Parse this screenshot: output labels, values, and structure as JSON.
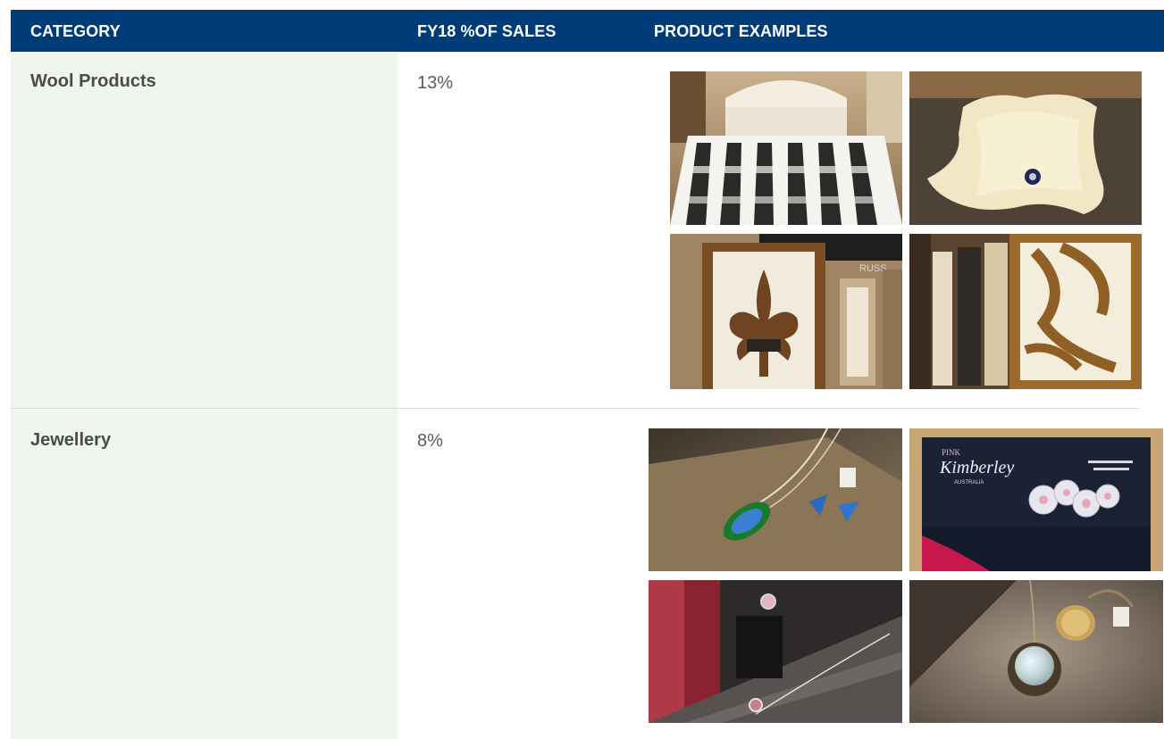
{
  "header": {
    "category": "CATEGORY",
    "sales": "FY18 %OF SALES",
    "examples": "PRODUCT EXAMPLES",
    "background": "#003c78"
  },
  "rows": [
    {
      "category": "Wool Products",
      "percent": "13%",
      "photos": [
        "striped-fur-bedspread-photo",
        "sheepskin-rug-photo",
        "fleur-de-lis-rug-photo",
        "zebra-pattern-rug-photo"
      ]
    },
    {
      "category": "Jewellery",
      "percent": "8%",
      "photos": [
        "opal-pendant-earrings-photo",
        "pink-kimberley-display-photo",
        "diamond-ring-necklace-photo",
        "opal-pendant-ring-photo"
      ]
    }
  ],
  "signage": {
    "brand_line1": "PINK",
    "brand_line2": "Kimberley",
    "brand_line3": "AUSTRALIA",
    "store_sign": "RUSS"
  },
  "colors": {
    "category_column": "#f1f5ef",
    "category_text": "#4a4a4a",
    "header_text": "#ffffff"
  }
}
